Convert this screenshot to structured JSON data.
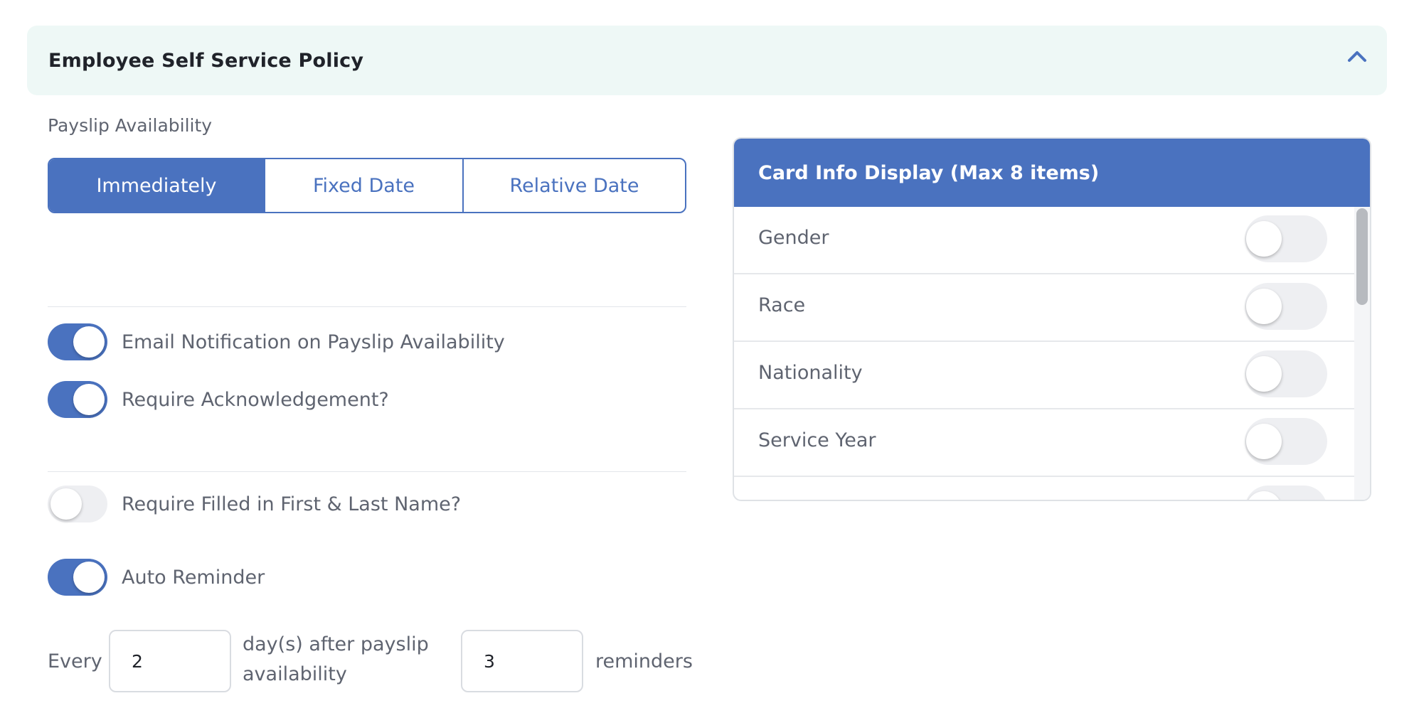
{
  "section": {
    "title": "Employee Self Service Policy"
  },
  "payslip": {
    "label": "Payslip Availability",
    "options": [
      "Immediately",
      "Fixed Date",
      "Relative Date"
    ],
    "selected": "Immediately"
  },
  "toggles": {
    "email_notification": {
      "label": "Email Notification on Payslip Availability",
      "on": true
    },
    "require_ack": {
      "label": "Require Acknowledgement?",
      "on": true
    },
    "require_name": {
      "label": "Require Filled in First & Last Name?",
      "on": false
    },
    "auto_reminder": {
      "label": "Auto Reminder",
      "on": true
    }
  },
  "reminder": {
    "every_label": "Every",
    "days_value": "2",
    "days_suffix_line1": "day(s) after payslip",
    "days_suffix_line2": "availability",
    "count_value": "3",
    "count_suffix": "reminders"
  },
  "card": {
    "title": "Card Info Display (Max 8 items)",
    "items": [
      {
        "label": "Gender",
        "on": false
      },
      {
        "label": "Race",
        "on": false
      },
      {
        "label": "Nationality",
        "on": false
      },
      {
        "label": "Service Year",
        "on": false
      }
    ]
  },
  "colors": {
    "accent": "#4a72bf",
    "header_bg": "#eef8f6"
  }
}
